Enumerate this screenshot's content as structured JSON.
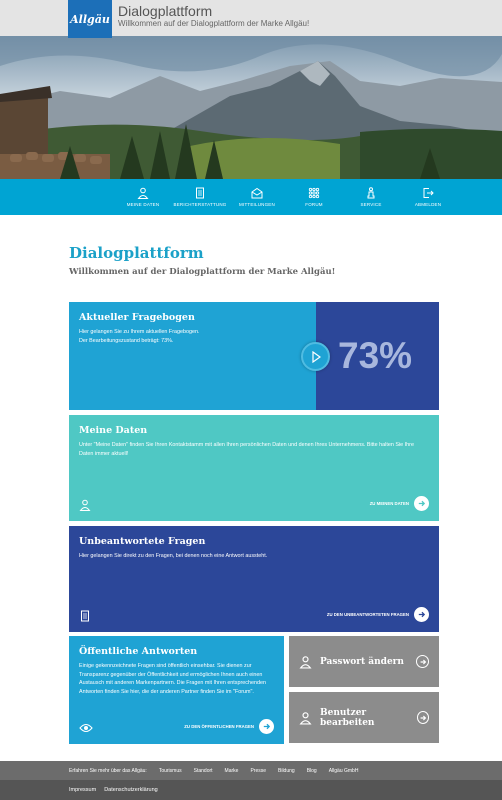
{
  "header": {
    "logo_text": "Allgäu",
    "title": "Dialogplattform",
    "subtitle": "Willkommen auf der Dialogplattform der Marke Allgäu!"
  },
  "nav": {
    "items": [
      {
        "label": "MEINE DATEN",
        "icon": "user-icon"
      },
      {
        "label": "BERICHTERSTATTUNG",
        "icon": "document-icon"
      },
      {
        "label": "MITTEILUNGEN",
        "icon": "envelope-icon"
      },
      {
        "label": "FORUM",
        "icon": "grid-icon"
      },
      {
        "label": "SERVICE",
        "icon": "person-info-icon"
      },
      {
        "label": "ABMELDEN",
        "icon": "logout-icon"
      }
    ]
  },
  "main": {
    "title": "Dialogplattform",
    "subtitle": "Willkommen auf der Dialogplattform der Marke Allgäu!"
  },
  "tiles": {
    "fragebogen": {
      "title": "Aktueller Fragebogen",
      "text1": "Hier gelangen Sie zu Ihrem aktuellen Fragebogen.",
      "text2": "Der Bearbeitungszustand beträgt: 73%.",
      "progress": "73%",
      "progress_value": 0.73
    },
    "meine_daten": {
      "title": "Meine Daten",
      "text": "Unter \"Meine Daten\" finden Sie Ihren Kontaktstamm mit allen Ihren persönlichen Daten und denen Ihres Unternehmens. Bitte halten Sie Ihre Daten immer aktuell!",
      "link": "ZU MEINEN DATEN"
    },
    "unbeantwortet": {
      "title": "Unbeantwortete Fragen",
      "text": "Hier gelangen Sie direkt zu den Fragen, bei denen noch eine Antwort aussteht.",
      "link": "ZU DEN UNBEANTWORTETEN FRAGEN"
    },
    "oeffentlich": {
      "title": "Öffentliche Antworten",
      "text": "Einige gekennzeichnete Fragen sind öffentlich einsehbar. Sie dienen zur Transparenz gegenüber der Öffentlichkeit und ermöglichen Ihnen auch einen Austausch mit anderen Markenpartnern. Die Fragen mit Ihren entsprechenden Antworten finden Sie hier, die der anderen Partner finden Sie im \"Forum\".",
      "link": "ZU DEN ÖFFENTLICHEN FRAGEN"
    },
    "passwort": {
      "label": "Passwort ändern"
    },
    "benutzer": {
      "label": "Benutzer bearbeiten"
    }
  },
  "colors": {
    "brand_blue": "#1c6fb8",
    "nav_cyan": "#00a4d3",
    "tile_cyan": "#1fa3d4",
    "tile_navy": "#2c4799",
    "tile_teal": "#4fc8c4",
    "tile_grey": "#8c8c8c"
  },
  "footer": {
    "lead": "Erfahren Sie mehr über das Allgäu:",
    "links": [
      "Tourismus",
      "Standort",
      "Marke",
      "Presse",
      "Bildung",
      "Blog",
      "Allgäu GmbH"
    ],
    "legal": [
      "Impressum",
      "Datenschutzerklärung"
    ]
  }
}
